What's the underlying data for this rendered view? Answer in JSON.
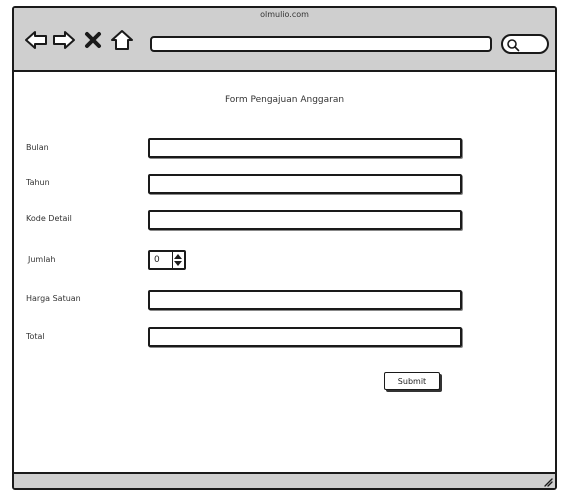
{
  "browser": {
    "site_title": "olmulio.com",
    "url": "",
    "search_query": ""
  },
  "form": {
    "title": "Form Pengajuan Anggaran",
    "fields": [
      {
        "label": "Bulan",
        "value": ""
      },
      {
        "label": "Tahun",
        "value": ""
      },
      {
        "label": "Kode Detail",
        "value": ""
      },
      {
        "label": "Jumlah",
        "value": "0"
      },
      {
        "label": "Harga Satuan",
        "value": ""
      },
      {
        "label": "Total",
        "value": ""
      }
    ],
    "submit_label": "Submit"
  },
  "icons": {
    "back": "back-arrow-icon",
    "forward": "forward-arrow-icon",
    "stop": "close-icon",
    "home": "home-icon",
    "search": "search-icon",
    "stepper": "stepper-arrows-icon",
    "resize": "resize-grip-icon"
  },
  "colors": {
    "toolbar": "#cfcfcf",
    "border": "#1a1a1a",
    "background": "#ffffff"
  }
}
